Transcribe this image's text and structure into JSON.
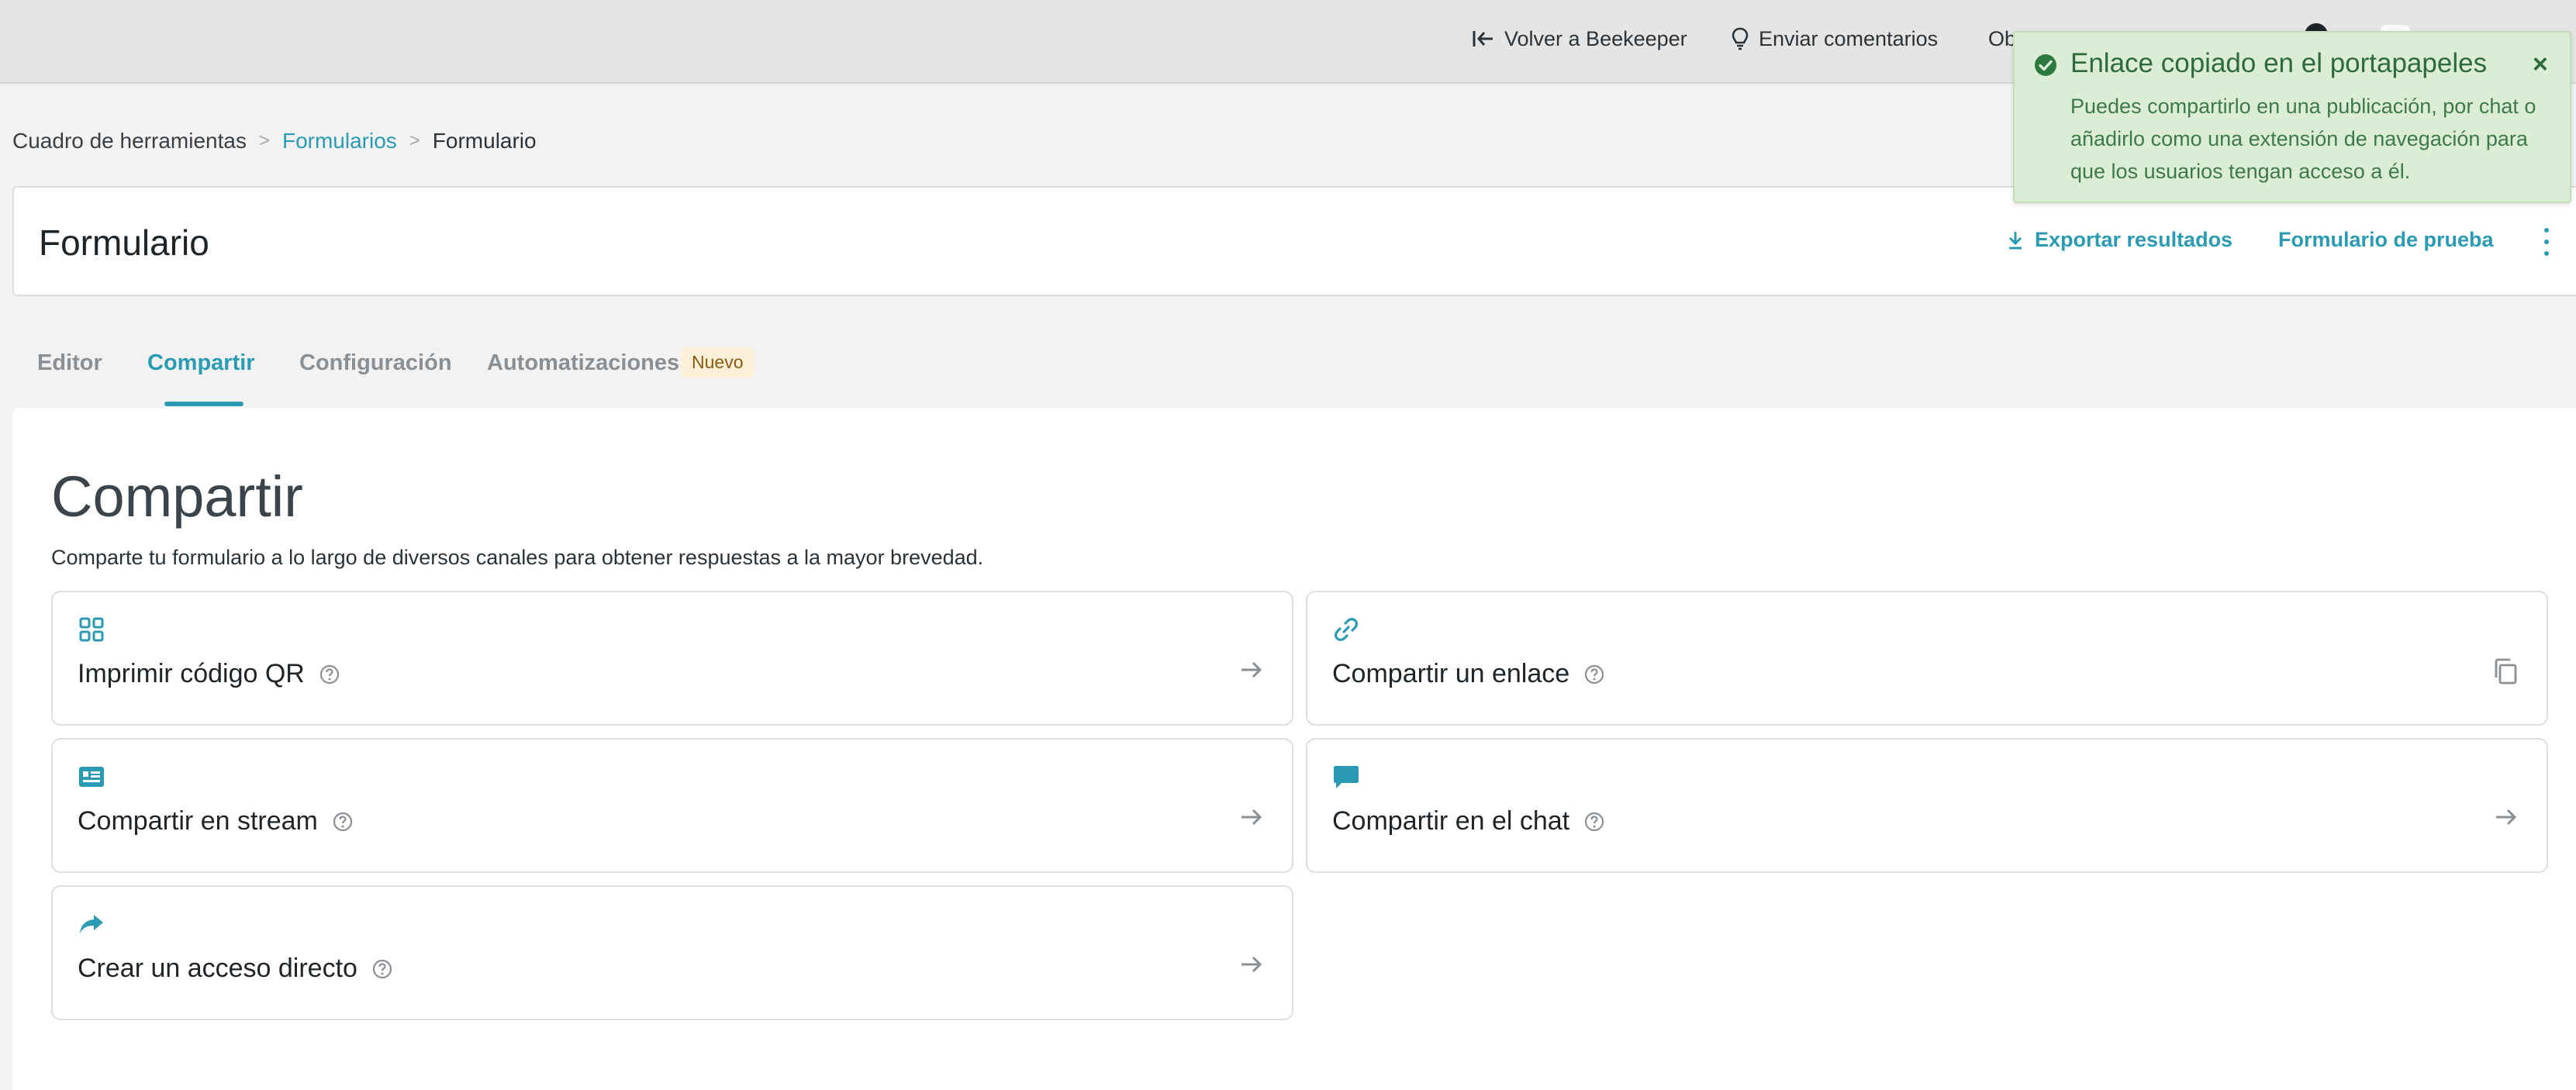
{
  "colors": {
    "accent": "#2a9bb3",
    "toast_bg": "#dcedd6",
    "toast_text": "#2d6b3a",
    "badge_bg": "#fdf0d9"
  },
  "topbar": {
    "back_label": "Volver a Beekeeper",
    "feedback_label": "Enviar comentarios",
    "partial_label": "Ob"
  },
  "breadcrumb": {
    "items": [
      "Cuadro de herramientas",
      "Formularios",
      "Formulario"
    ],
    "separator": ">"
  },
  "header": {
    "title": "Formulario",
    "export_label": "Exportar resultados",
    "test_label": "Formulario de prueba"
  },
  "tabs": {
    "items": [
      "Editor",
      "Compartir",
      "Configuración",
      "Automatizaciones"
    ],
    "active": "Compartir",
    "badge": "Nuevo"
  },
  "share": {
    "title": "Compartir",
    "description": "Comparte tu formulario a lo largo de diversos canales para obtener respuestas a la mayor brevedad.",
    "cards": [
      {
        "label": "Imprimir código QR",
        "icon": "qr-grid-icon",
        "action": "arrow-right-icon"
      },
      {
        "label": "Compartir un enlace",
        "icon": "link-icon",
        "action": "copy-icon"
      },
      {
        "label": "Compartir en stream",
        "icon": "stream-icon",
        "action": "arrow-right-icon"
      },
      {
        "label": "Compartir en el chat",
        "icon": "chat-bubble-icon",
        "action": "arrow-right-icon"
      },
      {
        "label": "Crear un acceso directo",
        "icon": "share-arrow-icon",
        "action": "arrow-right-icon"
      }
    ]
  },
  "toast": {
    "title": "Enlace copiado en el portapapeles",
    "message": "Puedes compartirlo en una publicación, por chat o añadirlo como una extensión de navegación para que los usuarios tengan acceso a él.",
    "close": "×"
  }
}
